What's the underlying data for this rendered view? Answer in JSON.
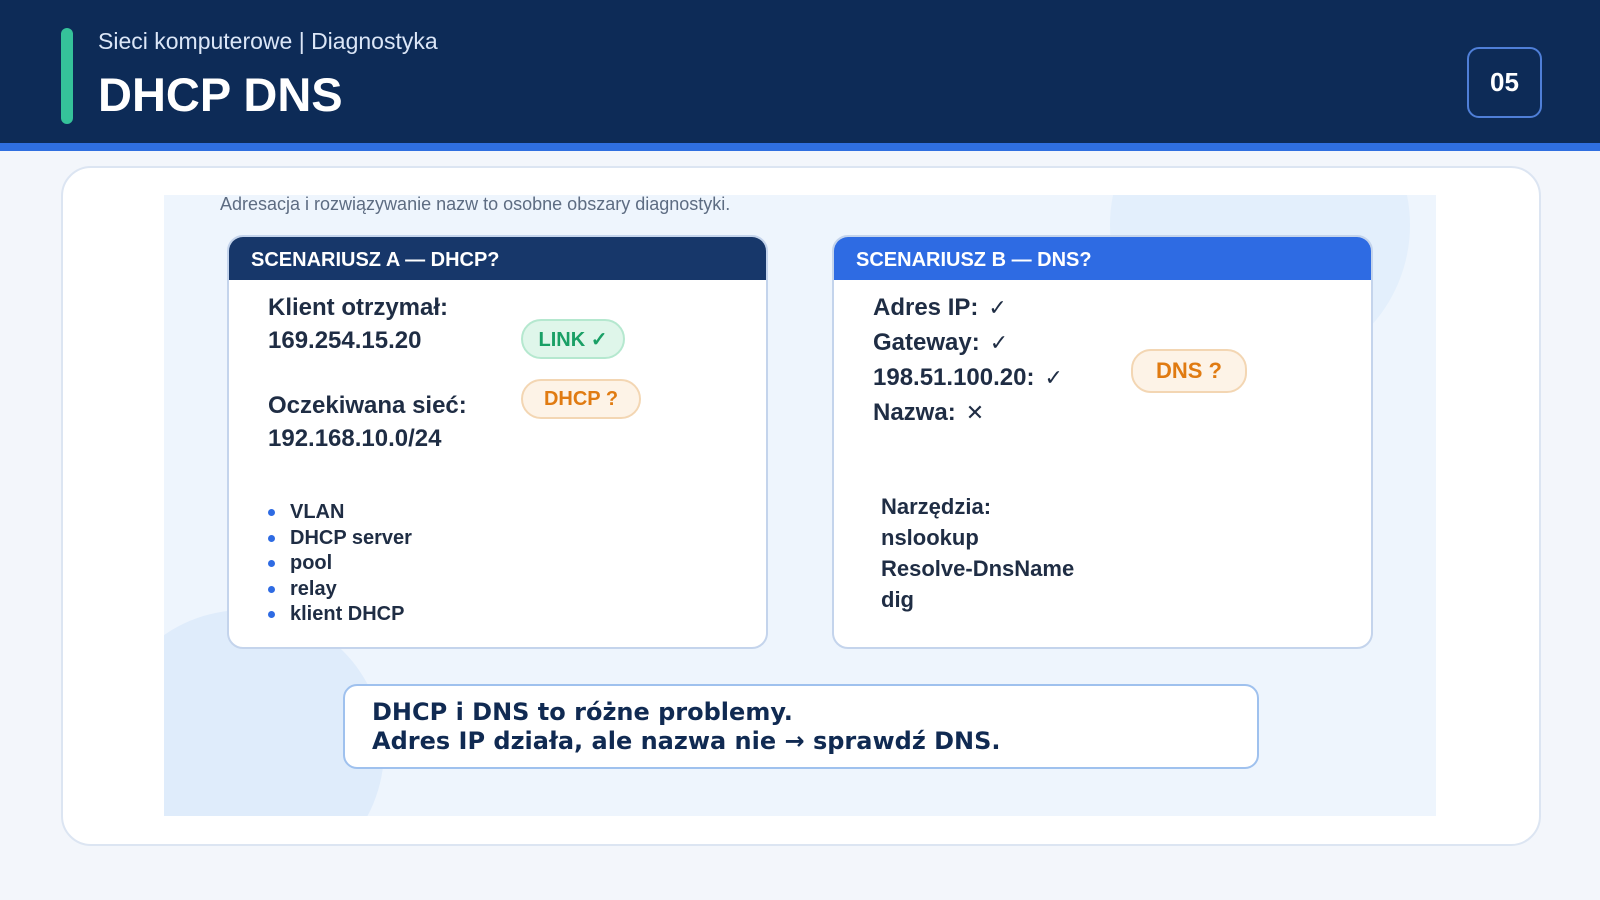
{
  "header": {
    "subtitle": "Sieci komputerowe | Diagnostyka",
    "title": "DHCP DNS",
    "page_number": "05"
  },
  "intro": "Adresacja i rozwiązywanie nazw to osobne obszary diagnostyki.",
  "scenario_a": {
    "heading": "SCENARIUSZ A — DHCP?",
    "received_label": "Klient otrzymał:",
    "received_value": "169.254.15.20",
    "expected_label": "Oczekiwana sieć:",
    "expected_value": "192.168.10.0/24",
    "badge_link": "LINK ✓",
    "badge_dhcp": "DHCP ?",
    "checklist": [
      "VLAN",
      "DHCP server",
      "pool",
      "relay",
      "klient DHCP"
    ]
  },
  "scenario_b": {
    "heading": "SCENARIUSZ B — DNS?",
    "checks": [
      {
        "label": "Adres IP:",
        "mark": "✓"
      },
      {
        "label": "Gateway:",
        "mark": "✓"
      },
      {
        "label": "198.51.100.20:",
        "mark": "✓"
      },
      {
        "label": "Nazwa:",
        "mark": "✕"
      }
    ],
    "badge_dns": "DNS ?",
    "tools_label": "Narzędzia:",
    "tools": [
      "nslookup",
      "Resolve-DnsName",
      "dig"
    ]
  },
  "callout": {
    "line1": "DHCP i DNS to różne problemy.",
    "line2": "Adres IP działa, ale nazwa nie → sprawdź DNS."
  },
  "colors": {
    "header_bg": "#0d2b57",
    "accent_green": "#35c29a",
    "accent_blue": "#2e6be3",
    "ok_green": "#1aa066",
    "warn_orange": "#e07b12"
  }
}
